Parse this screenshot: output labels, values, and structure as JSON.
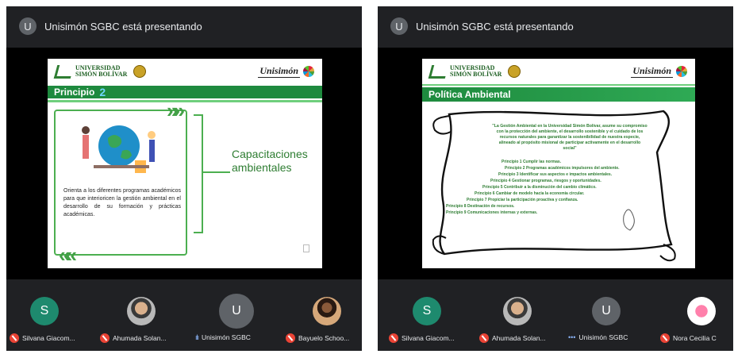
{
  "left": {
    "presenter_avatar": "U",
    "presenting_text": "Unisimón SGBC está presentando",
    "slide": {
      "university_name_line1": "UNIVERSIDAD",
      "university_name_line2": "SIMÓN BOLÍVAR",
      "brand": "Unisimón",
      "title": "Principio",
      "title_number": "2",
      "description": "Orienta a los diferentes programas académicos para que interioricen la gestión ambiental en el desarrollo de su formación y prácticas académicas.",
      "callout": "Capacitaciones ambientales"
    },
    "participants": [
      {
        "initial": "S",
        "name": "Silvana Giacom...",
        "mic": "off"
      },
      {
        "initial": "",
        "name": "Ahumada Solan...",
        "mic": "off"
      },
      {
        "initial": "U",
        "name": "Unisimón SGBC",
        "mic": "speaking"
      },
      {
        "initial": "",
        "name": "Bayuelo Schoo...",
        "mic": "off"
      }
    ]
  },
  "right": {
    "presenter_avatar": "U",
    "presenting_text": "Unisimón SGBC está presentando",
    "slide": {
      "university_name_line1": "UNIVERSIDAD",
      "university_name_line2": "SIMÓN BOLÍVAR",
      "brand": "Unisimón",
      "title": "Política Ambiental",
      "policy_statement": "\"La Gestión Ambiental en la Universidad Simón Bolívar, asume su compromiso con la protección del ambiente, el desarrollo sostenible y el cuidado de los recursos naturales para garantizar la sostenibilidad de nuestra especie, alineado al propósito misional de participar activamente en el desarrollo social\"",
      "principles": [
        "Principio 1 Cumplir las normas.",
        "Principio 2 Programas académicos impulsores del ambiente.",
        "Principio 3 Identificar sus aspectos e impactos ambientales.",
        "Principio 4 Gestionar programas, riesgos y oportunidades.",
        "Principio 5 Contribuir a la disminución del cambio climático.",
        "Principio 6 Cambiar de modelo hacia la economía circular.",
        "Principio 7 Propiciar la participación proactiva y confianza.",
        "Principio 8 Destinación de recursos.",
        "Principio 9 Comunicaciones internas y externas."
      ]
    },
    "participants": [
      {
        "initial": "S",
        "name": "Silvana Giacom...",
        "mic": "off"
      },
      {
        "initial": "",
        "name": "Ahumada Solan...",
        "mic": "off"
      },
      {
        "initial": "U",
        "name": "Unisimón SGBC",
        "mic": "dots"
      },
      {
        "initial": "",
        "name": "Nora Cecilia C",
        "mic": "off"
      }
    ]
  },
  "colors": {
    "meet_bg": "#202124",
    "slide_green": "#1e8a3e",
    "mic_off": "#ea4335",
    "speaking": "#8ab4f8"
  }
}
